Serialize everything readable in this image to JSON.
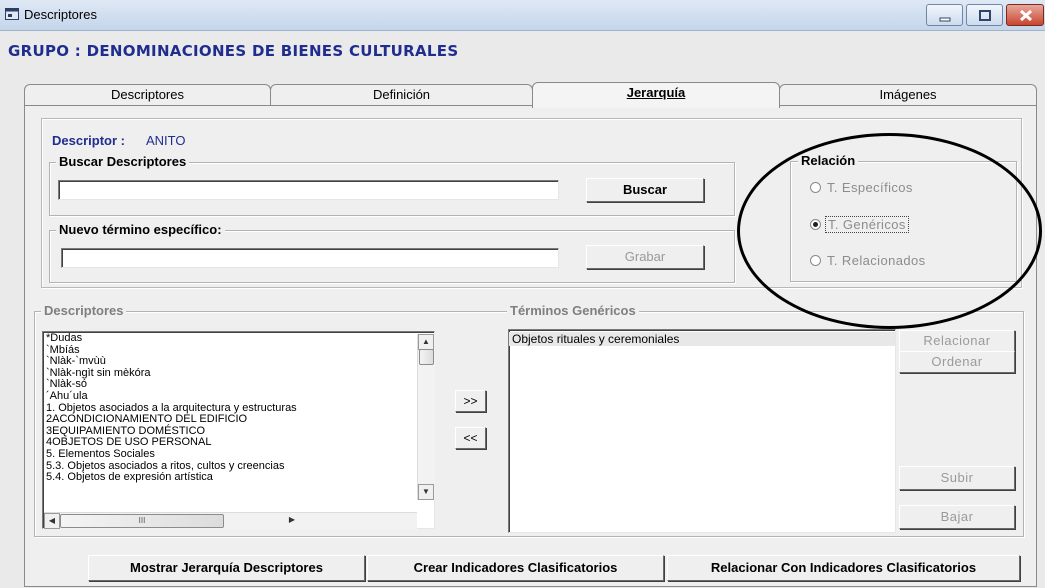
{
  "window": {
    "title": "Descriptores",
    "controls": [
      "minimize-icon",
      "maximize-icon",
      "close-icon"
    ]
  },
  "header": {
    "grupo": "GRUPO : DENOMINACIONES DE BIENES CULTURALES"
  },
  "tabs": [
    {
      "label": "Descriptores",
      "active": false
    },
    {
      "label": "Definición",
      "active": false
    },
    {
      "label": "Jerarquía",
      "active": true
    },
    {
      "label": "Imágenes",
      "active": false
    }
  ],
  "descriptor": {
    "label": "Descriptor :",
    "value": "ANITO"
  },
  "buscar": {
    "legend": "Buscar Descriptores",
    "value": "",
    "button": "Buscar"
  },
  "nuevo": {
    "legend": "Nuevo término específico:",
    "value": "",
    "button": "Grabar"
  },
  "relacion": {
    "legend": "Relación",
    "options": [
      {
        "label": "T. Específicos",
        "checked": false
      },
      {
        "label": "T. Genéricos",
        "checked": true
      },
      {
        "label": "T. Relacionados",
        "checked": false
      }
    ]
  },
  "descriptores_list": {
    "legend": "Descriptores",
    "items": [
      "*Dudas",
      "`Mbíás",
      "`Nlàk-`mvùù",
      "`Nlàk-ngìt sin mèkóra",
      "`Nlàk-só",
      "´Ahu´ula",
      "1. Objetos asociados a la arquitectura y estructuras",
      "2ACONDICIONAMIENTO DEL EDIFICIO",
      "3EQUIPAMIENTO DOMÉSTICO",
      "4OBJETOS DE USO PERSONAL",
      "5. Elementos Sociales",
      "5.3. Objetos asociados a ritos, cultos y creencias",
      "5.4. Objetos de expresión artística"
    ],
    "hscroll_thumb_label": "III"
  },
  "move_buttons": {
    "add": ">>",
    "remove": "<<"
  },
  "terminos": {
    "legend": "Términos Genéricos",
    "items": [
      "Objetos rituales y ceremoniales"
    ]
  },
  "side_buttons": {
    "relacionar": "Relacionar",
    "ordenar": "Ordenar",
    "subir": "Subir",
    "bajar": "Bajar"
  },
  "bottom_buttons": {
    "mostrar": "Mostrar Jerarquía Descriptores",
    "crear": "Crear Indicadores Clasificatorios",
    "relacionar_con": "Relacionar Con Indicadores Clasificatorios"
  }
}
